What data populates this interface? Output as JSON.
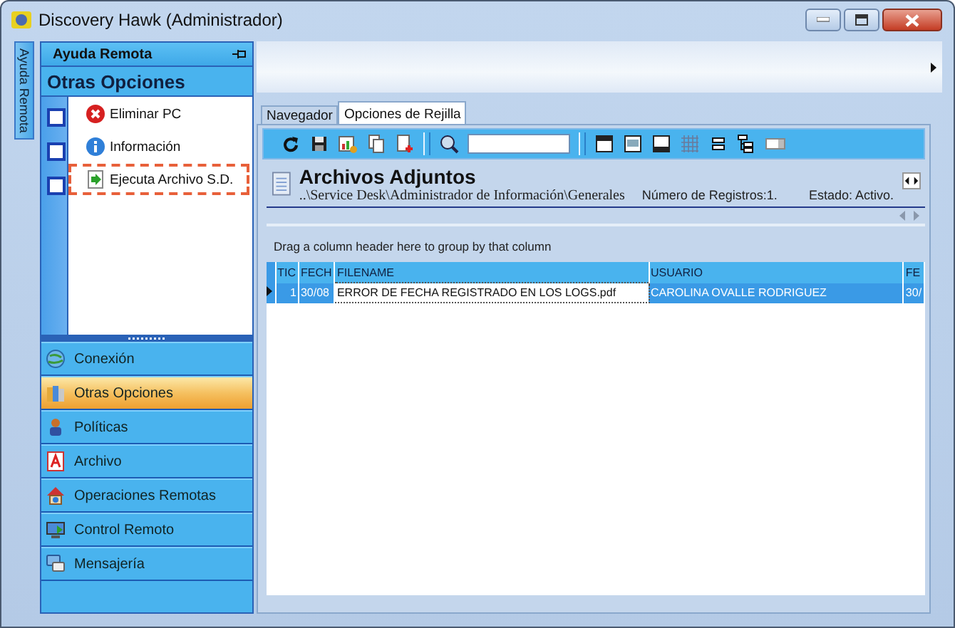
{
  "window": {
    "title": "Discovery Hawk (Administrador)"
  },
  "side_tab": {
    "label": "Ayuda Remota"
  },
  "panel": {
    "title": "Ayuda Remota",
    "section_title": "Otras Opciones",
    "items": [
      {
        "label": "Eliminar PC",
        "kind": "delete",
        "checked": false,
        "selected": false
      },
      {
        "label": "Información",
        "kind": "info",
        "checked": false,
        "selected": false
      },
      {
        "label": "Ejecuta Archivo S.D.",
        "kind": "run",
        "checked": false,
        "selected": true
      }
    ]
  },
  "nav": [
    {
      "label": "Conexión",
      "kind": "globe",
      "selected": false
    },
    {
      "label": "Otras Opciones",
      "kind": "books",
      "selected": true
    },
    {
      "label": "Políticas",
      "kind": "person",
      "selected": false
    },
    {
      "label": "Archivo",
      "kind": "pdf",
      "selected": false
    },
    {
      "label": "Operaciones Remotas",
      "kind": "house",
      "selected": false
    },
    {
      "label": "Control Remoto",
      "kind": "monitor",
      "selected": false
    },
    {
      "label": "Mensajería",
      "kind": "chat",
      "selected": false
    }
  ],
  "tabs": [
    {
      "label": "Navegador",
      "selected": false
    },
    {
      "label": "Opciones de Rejilla",
      "selected": true
    }
  ],
  "header": {
    "title": "Archivos Adjuntos",
    "path": "..\\Service Desk\\Administrador de Información\\Generales",
    "record_count": "Número de Registros:1.",
    "status": "Estado: Activo."
  },
  "group_hint": "Drag a column header here to group by that column",
  "table": {
    "columns": [
      "TIC",
      "FECH",
      "FILENAME",
      "USUARIO",
      "FE"
    ],
    "rows": [
      {
        "cells": [
          "1",
          "30/08",
          "ERROR DE FECHA REGISTRADO EN LOS LOGS.pdf",
          "CAROLINA OVALLE RODRIGUEZ",
          "30/"
        ],
        "selected": true
      }
    ]
  }
}
